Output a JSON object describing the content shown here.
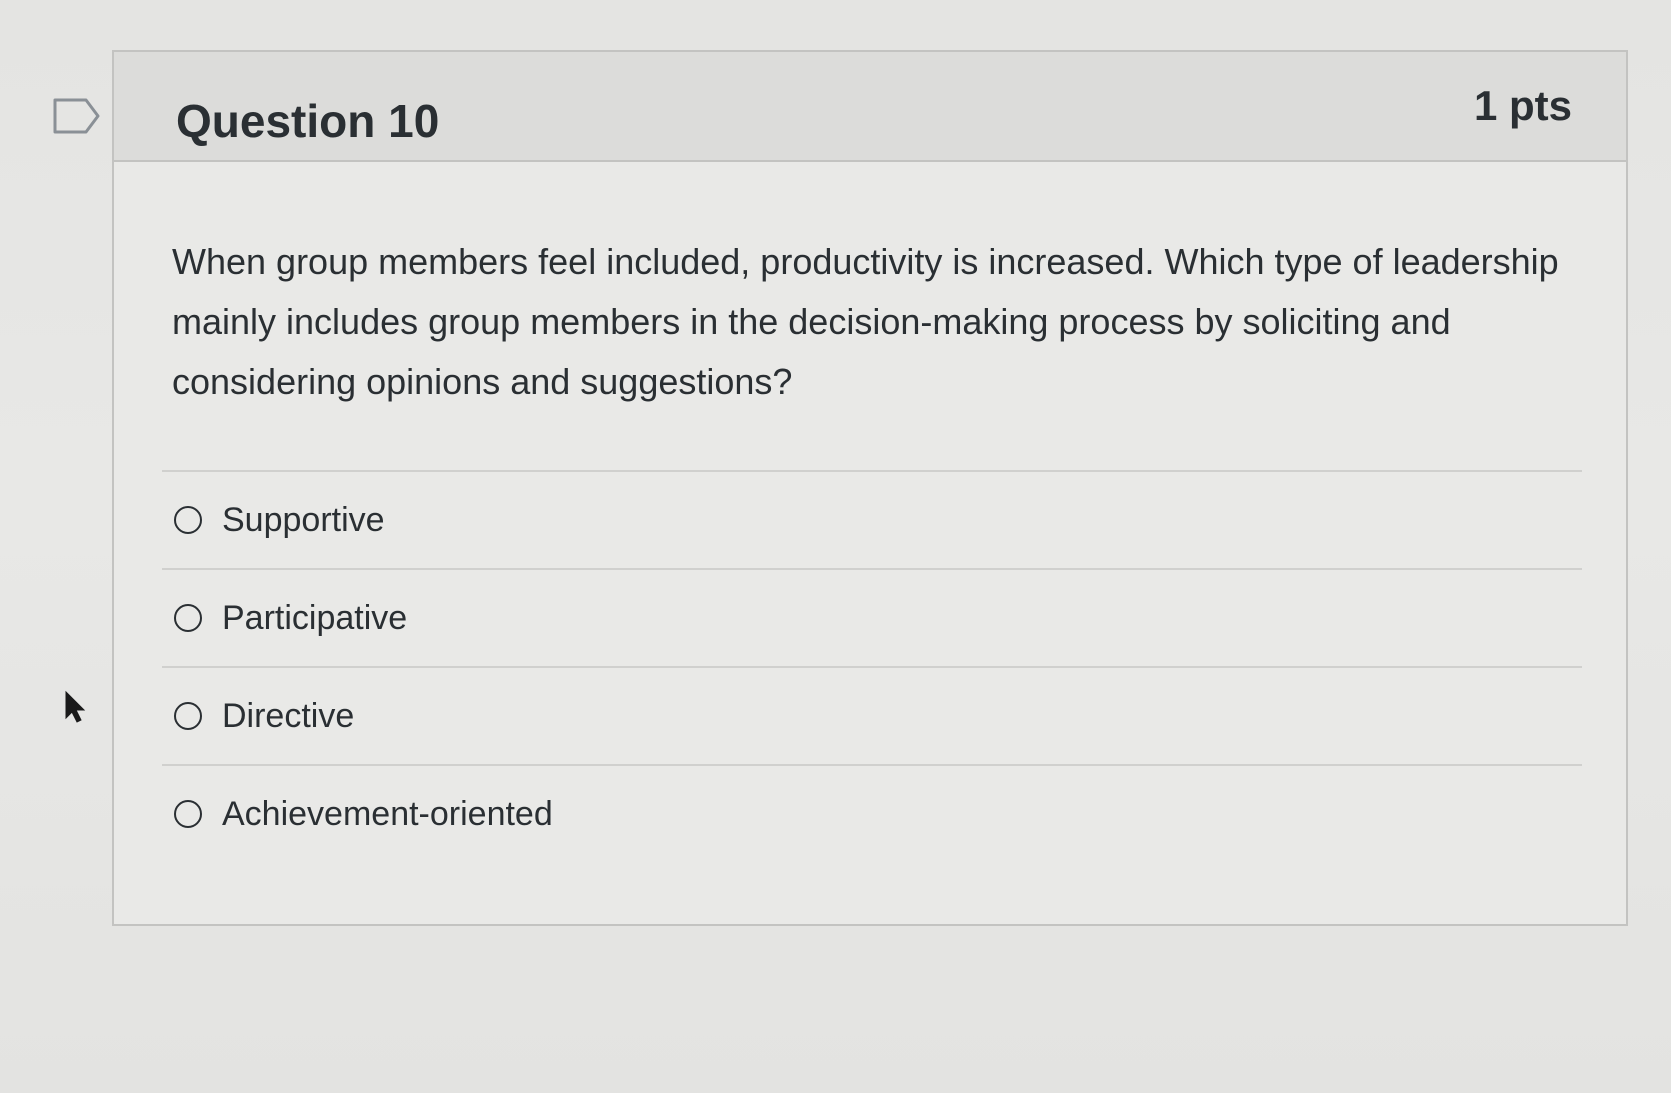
{
  "question": {
    "title": "Question 10",
    "points": "1 pts",
    "text": "When group members feel included, productivity is increased. Which type of leadership mainly includes group members in the decision-making process by soliciting and considering opinions and suggestions?",
    "answers": [
      {
        "label": "Supportive",
        "selected": false
      },
      {
        "label": "Participative",
        "selected": false
      },
      {
        "label": "Directive",
        "selected": false
      },
      {
        "label": "Achievement-oriented",
        "selected": false
      }
    ]
  },
  "icons": {
    "flag": "flag-icon",
    "cursor": "cursor-icon",
    "radio": "radio-icon"
  },
  "colors": {
    "text": "#2a2f33",
    "header_bg": "#dcdcda",
    "card_bg": "#e9e9e7",
    "border": "#c3c3c1"
  }
}
